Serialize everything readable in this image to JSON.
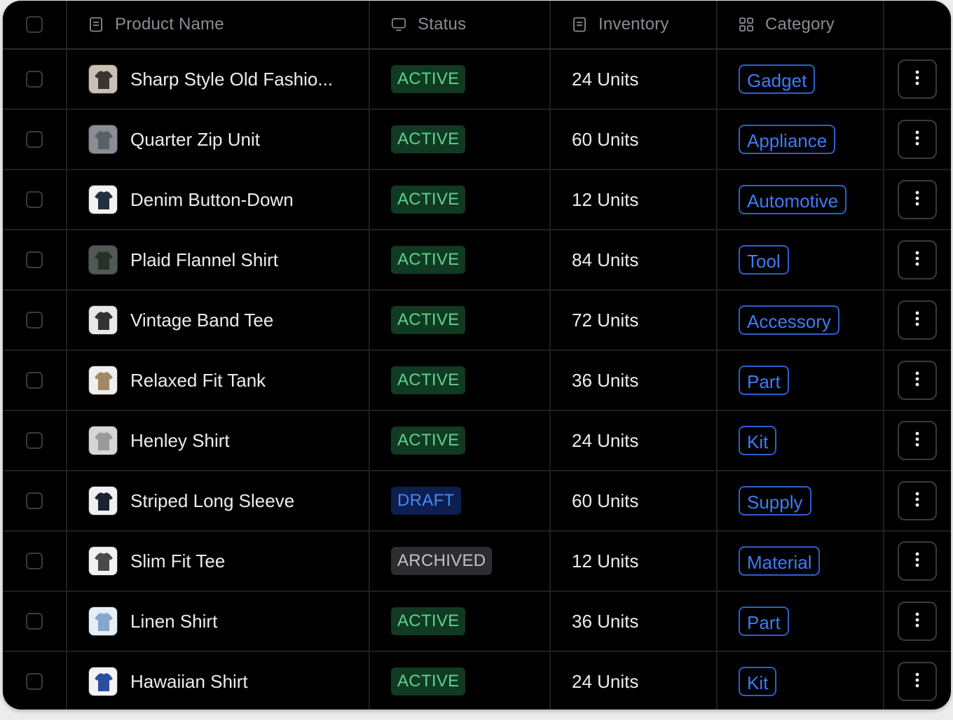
{
  "table": {
    "columns": [
      {
        "label": "Product Name",
        "icon": "document-icon"
      },
      {
        "label": "Status",
        "icon": "monitor-icon"
      },
      {
        "label": "Inventory",
        "icon": "document-icon"
      },
      {
        "label": "Category",
        "icon": "grid-icon"
      }
    ],
    "rows": [
      {
        "name": "Sharp Style Old Fashio...",
        "status": "ACTIVE",
        "inventory": "24 Units",
        "category": "Gadget",
        "thumb_colors": [
          "#c9c2b4",
          "#3a3530"
        ]
      },
      {
        "name": "Quarter Zip Unit",
        "status": "ACTIVE",
        "inventory": "60 Units",
        "category": "Appliance",
        "thumb_colors": [
          "#8a8e94",
          "#5b6068"
        ]
      },
      {
        "name": "Denim Button-Down",
        "status": "ACTIVE",
        "inventory": "12 Units",
        "category": "Automotive",
        "thumb_colors": [
          "#f2f2f2",
          "#23303f"
        ]
      },
      {
        "name": "Plaid Flannel Shirt",
        "status": "ACTIVE",
        "inventory": "84 Units",
        "category": "Tool",
        "thumb_colors": [
          "#4f5a52",
          "#2b2f2c"
        ]
      },
      {
        "name": "Vintage Band Tee",
        "status": "ACTIVE",
        "inventory": "72 Units",
        "category": "Accessory",
        "thumb_colors": [
          "#e8e8e8",
          "#333333"
        ]
      },
      {
        "name": "Relaxed Fit Tank",
        "status": "ACTIVE",
        "inventory": "36 Units",
        "category": "Part",
        "thumb_colors": [
          "#efefef",
          "#a38963"
        ]
      },
      {
        "name": "Henley Shirt",
        "status": "ACTIVE",
        "inventory": "24 Units",
        "category": "Kit",
        "thumb_colors": [
          "#d6d6d6",
          "#9a9a9a"
        ]
      },
      {
        "name": "Striped Long Sleeve",
        "status": "DRAFT",
        "inventory": "60 Units",
        "category": "Supply",
        "thumb_colors": [
          "#f0f0f0",
          "#1c2230"
        ]
      },
      {
        "name": "Slim Fit Tee",
        "status": "ARCHIVED",
        "inventory": "12 Units",
        "category": "Material",
        "thumb_colors": [
          "#f2f2f2",
          "#4a4a4a"
        ]
      },
      {
        "name": "Linen Shirt",
        "status": "ACTIVE",
        "inventory": "36 Units",
        "category": "Part",
        "thumb_colors": [
          "#e6eef6",
          "#86a6cc"
        ]
      },
      {
        "name": "Hawaiian Shirt",
        "status": "ACTIVE",
        "inventory": "24 Units",
        "category": "Kit",
        "thumb_colors": [
          "#f3f3f3",
          "#2b4f9e"
        ]
      }
    ]
  },
  "status_colors": {
    "ACTIVE": {
      "bg": "#103a22",
      "fg": "#5fd18e"
    },
    "DRAFT": {
      "bg": "#0c1f4f",
      "fg": "#4a86f7"
    },
    "ARCHIVED": {
      "bg": "#2d2d30",
      "fg": "#c2c2c6"
    }
  },
  "accent": "#3f7bf5",
  "row_action_icon": "more-vertical-icon"
}
